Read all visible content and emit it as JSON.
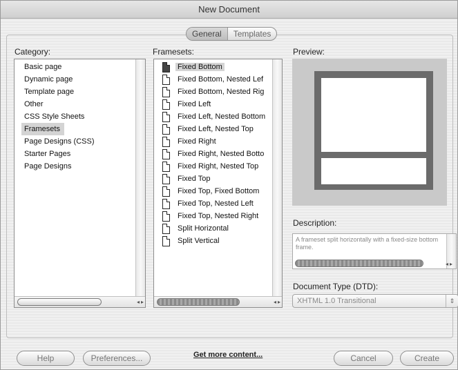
{
  "window": {
    "title": "New Document"
  },
  "tabs": [
    {
      "label": "General",
      "active": true
    },
    {
      "label": "Templates",
      "active": false
    }
  ],
  "category": {
    "label": "Category:",
    "items": [
      "Basic page",
      "Dynamic page",
      "Template page",
      "Other",
      "CSS Style Sheets",
      "Framesets",
      "Page Designs (CSS)",
      "Starter Pages",
      "Page Designs"
    ],
    "selected": "Framesets"
  },
  "framesets": {
    "label": "Framesets:",
    "items": [
      "Fixed Bottom",
      "Fixed Bottom, Nested Lef",
      "Fixed Bottom, Nested Rig",
      "Fixed Left",
      "Fixed Left, Nested Bottom",
      "Fixed Left, Nested Top",
      "Fixed Right",
      "Fixed Right, Nested Botto",
      "Fixed Right, Nested Top",
      "Fixed Top",
      "Fixed Top, Fixed Bottom",
      "Fixed Top, Nested Left",
      "Fixed Top, Nested Right",
      "Split Horizontal",
      "Split Vertical"
    ],
    "selected": "Fixed Bottom"
  },
  "preview": {
    "label": "Preview:"
  },
  "description": {
    "label": "Description:",
    "text": "A frameset split horizontally with a fixed-size bottom frame."
  },
  "doctype": {
    "label": "Document Type (DTD):",
    "value": "XHTML 1.0 Transitional"
  },
  "buttons": {
    "help": "Help",
    "preferences": "Preferences...",
    "get_more": "Get more content...",
    "cancel": "Cancel",
    "create": "Create"
  },
  "icons": {
    "page": "document-page-icon",
    "scroll_left": "◂",
    "scroll_right": "▸",
    "updown": "⇕"
  }
}
